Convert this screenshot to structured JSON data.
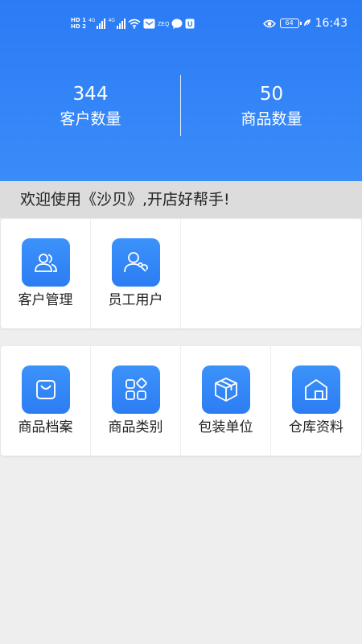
{
  "status_bar": {
    "sim1_label": "HD 1",
    "sim2_label": "HD 2",
    "net1": "4G",
    "net2": "4G",
    "battery": "64",
    "time": "16:43"
  },
  "stats": [
    {
      "value": "344",
      "label": "客户数量"
    },
    {
      "value": "50",
      "label": "商品数量"
    }
  ],
  "welcome_text": "欢迎使用《沙贝》,开店好帮手!",
  "section1": [
    {
      "label": "客户管理",
      "icon": "customers-icon"
    },
    {
      "label": "员工用户",
      "icon": "staff-user-icon"
    }
  ],
  "section2": [
    {
      "label": "商品档案",
      "icon": "product-bag-icon"
    },
    {
      "label": "商品类别",
      "icon": "category-grid-icon"
    },
    {
      "label": "包装单位",
      "icon": "package-box-icon"
    },
    {
      "label": "仓库资料",
      "icon": "warehouse-icon"
    }
  ],
  "colors": {
    "header_blue": "#2b7bf5",
    "icon_blue": "#3388f8",
    "welcome_bg": "#dcdcdc",
    "page_bg": "#eeeeee"
  }
}
